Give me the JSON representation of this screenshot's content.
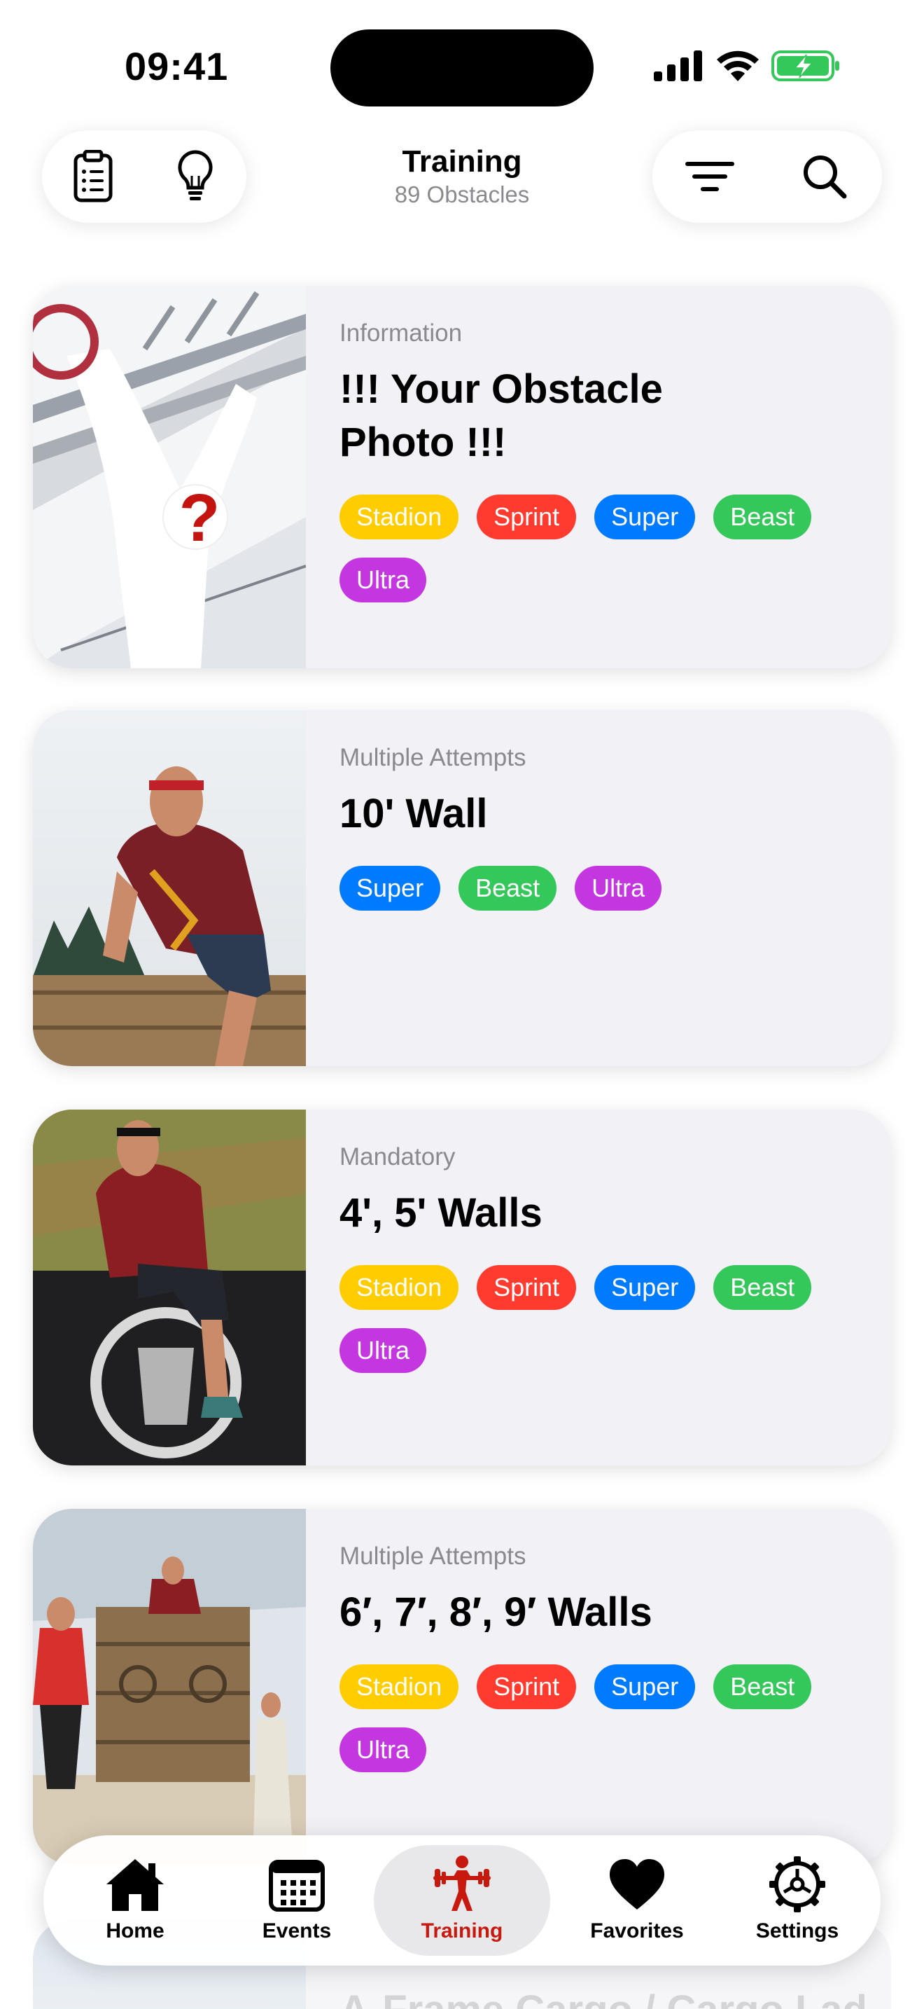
{
  "status_bar": {
    "time": "09:41"
  },
  "header": {
    "title": "Training",
    "subtitle": "89 Obstacles",
    "left_icons": [
      "clipboard-list-icon",
      "lightbulb-icon"
    ],
    "right_icons": [
      "filter-lines-icon",
      "search-icon"
    ]
  },
  "tag_colors": {
    "Stadion": "#ffcc00",
    "Sprint": "#ff3b30",
    "Super": "#007aff",
    "Beast": "#34c759",
    "Ultra": "#c336e0"
  },
  "cards": [
    {
      "category": "Information",
      "title": "!!! Your Obstacle Photo !!!",
      "tags": [
        "Stadion",
        "Sprint",
        "Super",
        "Beast",
        "Ultra"
      ]
    },
    {
      "category": "Multiple Attempts",
      "title": "10' Wall",
      "tags": [
        "Super",
        "Beast",
        "Ultra"
      ]
    },
    {
      "category": "Mandatory",
      "title": "4', 5' Walls",
      "tags": [
        "Stadion",
        "Sprint",
        "Super",
        "Beast",
        "Ultra"
      ]
    },
    {
      "category": "Multiple Attempts",
      "title": "6′, 7′, 8′, 9′ Walls",
      "tags": [
        "Stadion",
        "Sprint",
        "Super",
        "Beast",
        "Ultra"
      ]
    }
  ],
  "peek": {
    "title": "A-Frame Cargo / Cargo Lad"
  },
  "tab_bar": {
    "tabs": [
      {
        "label": "Home",
        "icon": "house-icon"
      },
      {
        "label": "Events",
        "icon": "calendar-icon"
      },
      {
        "label": "Training",
        "icon": "weightlifter-icon",
        "active": true
      },
      {
        "label": "Favorites",
        "icon": "heart-icon"
      },
      {
        "label": "Settings",
        "icon": "gear-icon"
      }
    ],
    "active_color": "#c8190f"
  }
}
